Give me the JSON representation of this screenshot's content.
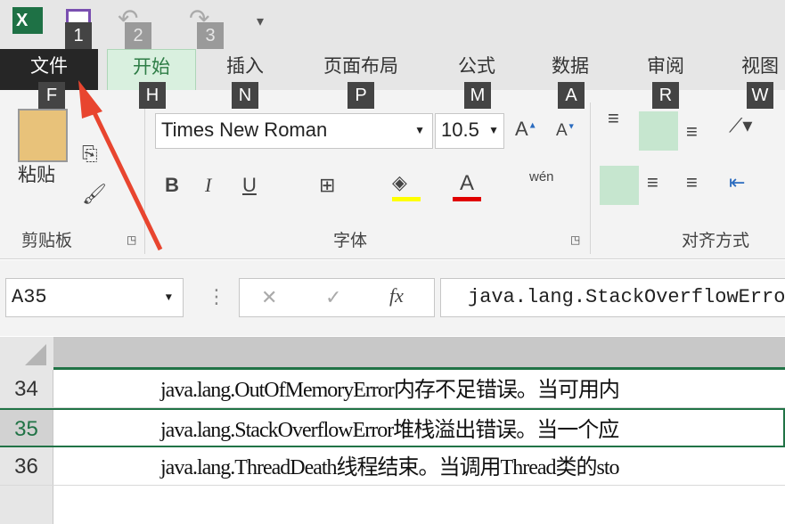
{
  "qat": {
    "keys": [
      "1",
      "2",
      "3"
    ]
  },
  "tabs": [
    {
      "label": "文件",
      "key": "F"
    },
    {
      "label": "开始",
      "key": "H"
    },
    {
      "label": "插入",
      "key": "N"
    },
    {
      "label": "页面布局",
      "key": "P"
    },
    {
      "label": "公式",
      "key": "M"
    },
    {
      "label": "数据",
      "key": "A"
    },
    {
      "label": "审阅",
      "key": "R"
    },
    {
      "label": "视图",
      "key": "W"
    }
  ],
  "ribbon": {
    "paste_label": "粘贴",
    "clipboard_group": "剪贴板",
    "font_group": "字体",
    "align_group": "对齐方式",
    "font_name": "Times New Roman",
    "font_size": "10.5",
    "bold": "B",
    "italic": "I",
    "underline": "U",
    "phonetic": "wén",
    "accent": "#217346",
    "highlight_color": "#ffff00",
    "font_color": "#e00000"
  },
  "formula_bar": {
    "name_box": "A35",
    "fx": "fx",
    "content": "java.lang.StackOverflowError"
  },
  "rows": [
    {
      "num": "34",
      "text": "java.lang.OutOfMemoryError内存不足错误。当可用内"
    },
    {
      "num": "35",
      "text": "java.lang.StackOverflowError堆栈溢出错误。当一个应"
    },
    {
      "num": "36",
      "text": "java.lang.ThreadDeath线程结束。当调用Thread类的sto"
    }
  ]
}
